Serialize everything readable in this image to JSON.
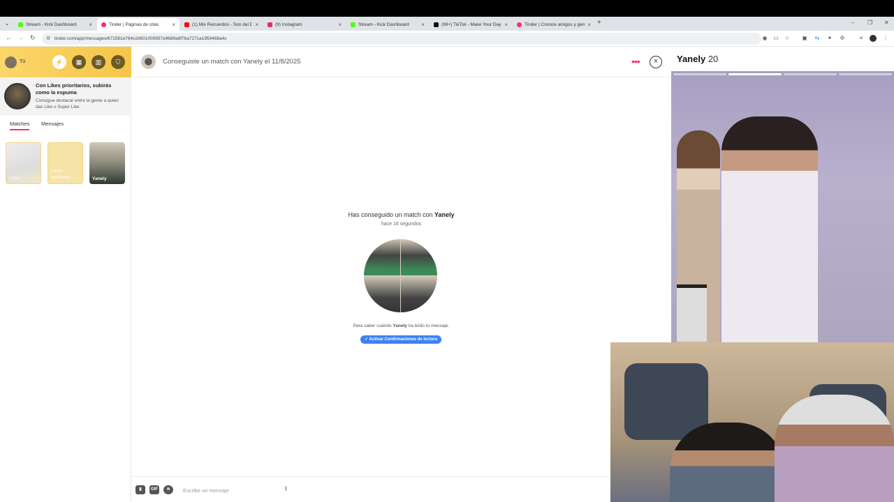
{
  "browser": {
    "tabs": [
      {
        "title": "Stream - Kick Dashboard",
        "favicon_color": "#53fc18",
        "active": false
      },
      {
        "title": "Tinder | Páginas de citas",
        "favicon_color": "#fd2d64",
        "active": true
      },
      {
        "title": "(1) Mix Recuerdos - Son del Du",
        "favicon_color": "#ff0000",
        "active": false
      },
      {
        "title": "(9) Instagram",
        "favicon_color": "#e1306c",
        "active": false
      },
      {
        "title": "Stream - Kick Dashboard",
        "favicon_color": "#53fc18",
        "active": false
      },
      {
        "title": "(99+) TikTok - Make Your Day",
        "favicon_color": "#111111",
        "active": false
      },
      {
        "title": "Tinder | Conoce amigos y gent",
        "favicon_color": "#fd2d64",
        "active": false
      }
    ],
    "url": "tinder.com/app/messages/671581e764cd3601005657e9689a8f7ba727ca1959468a4c"
  },
  "sidebar": {
    "me_label": "Tú",
    "promo": {
      "title": "Con Likes prioritarios, subirás como la espuma",
      "subtitle": "Consigue destacar entre la gente a quien das Like o Super Like"
    },
    "tabs": [
      "Matches",
      "Mensajes"
    ],
    "matches": [
      {
        "label": "Likes"
      },
      {
        "label": "Likes enviados"
      },
      {
        "label": "Yanely"
      }
    ]
  },
  "chat": {
    "header_title": "Conseguiste un match con Yanely el 11/8/2025",
    "match_text_prefix": "Has conseguido un match con",
    "match_name": "Yanely",
    "match_time": "hace 16 segundos",
    "read_prefix": "Para saber cuándo",
    "read_name": "Yanely",
    "read_suffix": "ha leído tu mensaje.",
    "read_button": "✓ Activar Confirmaciones de lectura",
    "composer_placeholder": "Escribe un mensaje",
    "gif_label": "GIF"
  },
  "profile": {
    "name": "Yanely",
    "age": "20",
    "photo_count": 4,
    "photo_index": 2
  },
  "colors": {
    "brand": "#fd2d64",
    "gold": "#f4c64a",
    "link_blue": "#3b82f6"
  }
}
